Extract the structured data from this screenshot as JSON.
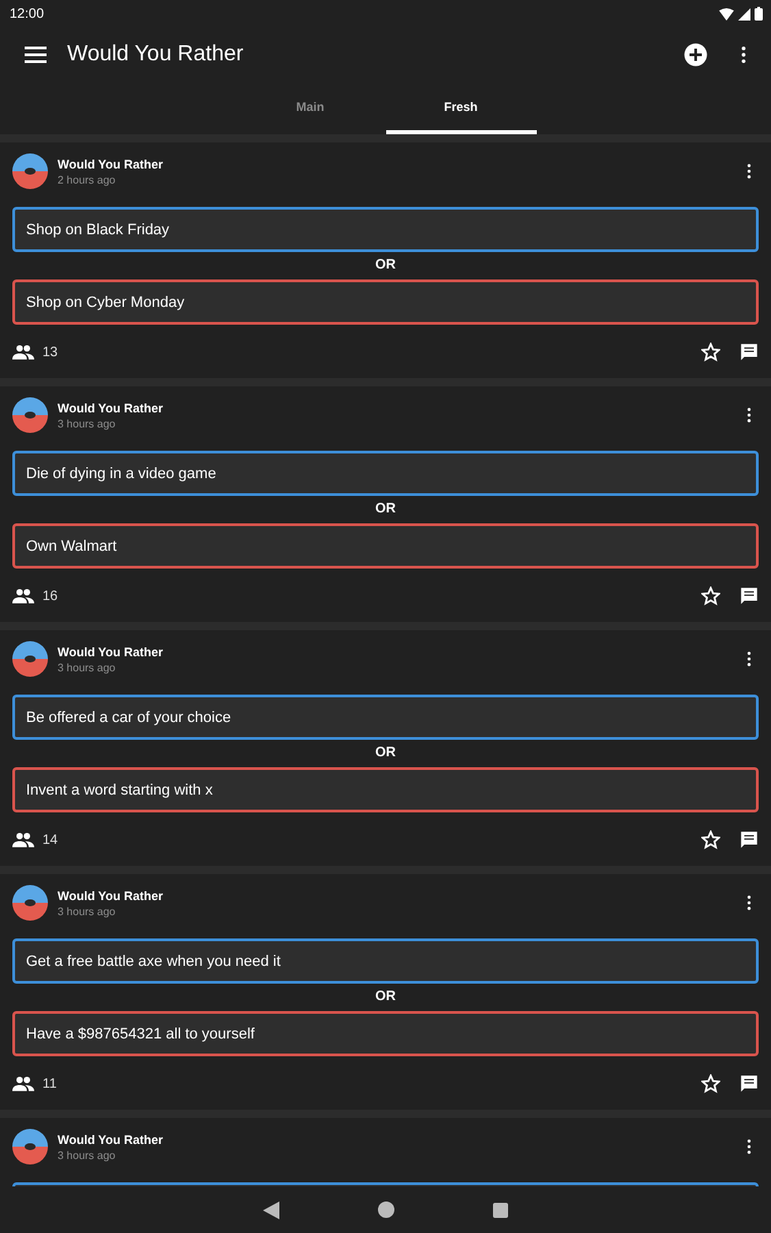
{
  "status_bar": {
    "time": "12:00"
  },
  "app_bar": {
    "title": "Would You Rather"
  },
  "tabs": [
    {
      "label": "Main",
      "selected": false
    },
    {
      "label": "Fresh",
      "selected": true
    }
  ],
  "posts": [
    {
      "author": "Would You Rather",
      "time": "2 hours ago",
      "options": [
        {
          "text": "Shop on Black Friday",
          "color": "#3d8fd9"
        },
        {
          "text": "Shop on Cyber Monday",
          "color": "#d9544d"
        }
      ],
      "separator": "OR",
      "votes": "13"
    },
    {
      "author": "Would You Rather",
      "time": "3 hours ago",
      "options": [
        {
          "text": "Die of dying in a video game",
          "color": "#3d8fd9"
        },
        {
          "text": "Own Walmart",
          "color": "#d9544d"
        }
      ],
      "separator": "OR",
      "votes": "16"
    },
    {
      "author": "Would You Rather",
      "time": "3 hours ago",
      "options": [
        {
          "text": "Be offered a car of your choice",
          "color": "#3d8fd9"
        },
        {
          "text": "Invent a word starting with x",
          "color": "#d9544d"
        }
      ],
      "separator": "OR",
      "votes": "14"
    },
    {
      "author": "Would You Rather",
      "time": "3 hours ago",
      "options": [
        {
          "text": "Get a free battle axe when you need it",
          "color": "#3d8fd9"
        },
        {
          "text": "Have a $987654321 all to yourself",
          "color": "#d9544d"
        }
      ],
      "separator": "OR",
      "votes": "11"
    },
    {
      "author": "Would You Rather",
      "time": "3 hours ago",
      "kind": "partial"
    }
  ]
}
